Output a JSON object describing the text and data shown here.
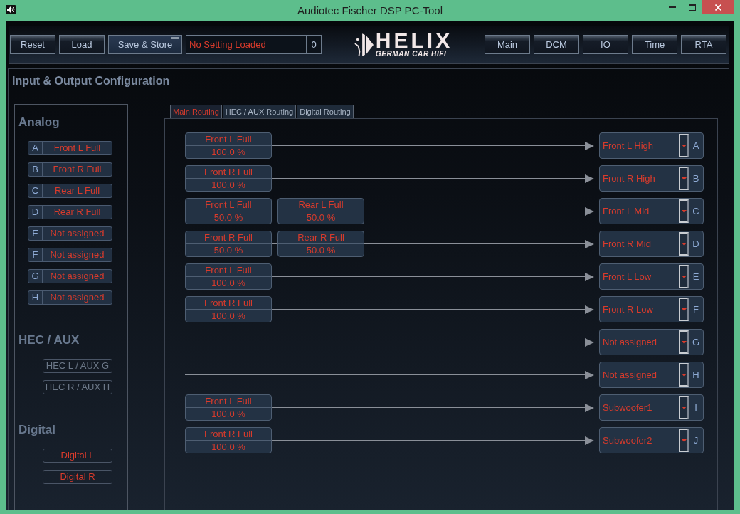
{
  "window": {
    "title": "Audiotec Fischer DSP PC-Tool"
  },
  "toolbar": {
    "left_buttons": [
      {
        "label": "Reset",
        "highlighted": false
      },
      {
        "label": "Load",
        "highlighted": false
      },
      {
        "label": "Save & Store",
        "highlighted": true
      }
    ],
    "status": {
      "text": "No Setting Loaded",
      "count": "0"
    },
    "logo": {
      "wordmark": "HELIX",
      "tagline": "GERMAN CAR HIFI"
    },
    "nav_buttons": [
      "Main",
      "DCM",
      "IO",
      "Time",
      "RTA"
    ]
  },
  "page": {
    "title": "Input & Output Configuration"
  },
  "inputs": {
    "groups": [
      {
        "title": "Analog",
        "kind": "lettered",
        "channels": [
          {
            "letter": "A",
            "name": "Front L Full"
          },
          {
            "letter": "B",
            "name": "Front R Full"
          },
          {
            "letter": "C",
            "name": "Rear L Full"
          },
          {
            "letter": "D",
            "name": "Rear R Full"
          },
          {
            "letter": "E",
            "name": "Not assigned"
          },
          {
            "letter": "F",
            "name": "Not assigned"
          },
          {
            "letter": "G",
            "name": "Not assigned"
          },
          {
            "letter": "H",
            "name": "Not assigned"
          }
        ]
      },
      {
        "title": "HEC / AUX",
        "kind": "plain",
        "channels": [
          {
            "name": "HEC L / AUX G",
            "disabled": true
          },
          {
            "name": "HEC R / AUX H",
            "disabled": true
          }
        ]
      },
      {
        "title": "Digital",
        "kind": "plain",
        "channels": [
          {
            "name": "Digital L",
            "disabled": false
          },
          {
            "name": "Digital R",
            "disabled": false
          }
        ]
      }
    ]
  },
  "routing": {
    "tabs": [
      {
        "label": "Main Routing",
        "selected": true
      },
      {
        "label": "HEC / AUX Routing",
        "selected": false
      },
      {
        "label": "Digital Routing",
        "selected": false
      }
    ],
    "rows": [
      {
        "sources": [
          {
            "name": "Front L Full",
            "share": "100.0 %"
          }
        ],
        "output": "Front L High",
        "letter": "A"
      },
      {
        "sources": [
          {
            "name": "Front R Full",
            "share": "100.0 %"
          }
        ],
        "output": "Front R High",
        "letter": "B"
      },
      {
        "sources": [
          {
            "name": "Front L Full",
            "share": "50.0 %"
          },
          {
            "name": "Rear L Full",
            "share": "50.0 %"
          }
        ],
        "output": "Front L Mid",
        "letter": "C"
      },
      {
        "sources": [
          {
            "name": "Front R Full",
            "share": "50.0 %"
          },
          {
            "name": "Rear R Full",
            "share": "50.0 %"
          }
        ],
        "output": "Front R Mid",
        "letter": "D"
      },
      {
        "sources": [
          {
            "name": "Front L Full",
            "share": "100.0 %"
          }
        ],
        "output": "Front L Low",
        "letter": "E"
      },
      {
        "sources": [
          {
            "name": "Front R Full",
            "share": "100.0 %"
          }
        ],
        "output": "Front R Low",
        "letter": "F"
      },
      {
        "output": "Not assigned",
        "letter": "G"
      },
      {
        "output": "Not assigned",
        "letter": "H"
      },
      {
        "sources": [
          {
            "name": "Front L Full",
            "share": "100.0 %"
          }
        ],
        "output": "Subwoofer1",
        "letter": "I"
      },
      {
        "sources": [
          {
            "name": "Front R Full",
            "share": "100.0 %"
          }
        ],
        "output": "Subwoofer2",
        "letter": "J"
      }
    ]
  }
}
